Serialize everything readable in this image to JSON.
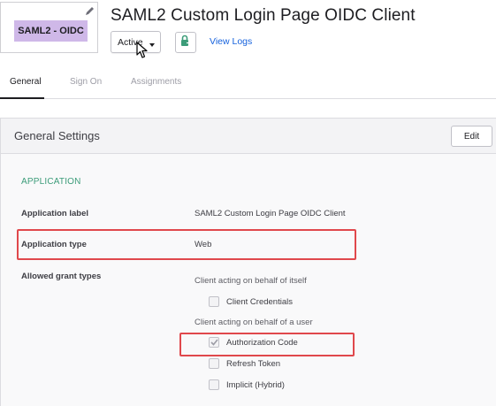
{
  "app": {
    "logo_label": "SAML2 - OIDC",
    "title": "SAML2 Custom Login Page OIDC Client",
    "status": "Active",
    "view_logs": "View Logs"
  },
  "tabs": [
    {
      "label": "General",
      "active": true
    },
    {
      "label": "Sign On",
      "active": false
    },
    {
      "label": "Assignments",
      "active": false
    }
  ],
  "panel": {
    "title": "General Settings",
    "edit_label": "Edit",
    "section": "APPLICATION",
    "fields": {
      "app_label": {
        "label": "Application label",
        "value": "SAML2 Custom Login Page OIDC Client"
      },
      "app_type": {
        "label": "Application type",
        "value": "Web"
      },
      "grant_types": {
        "label": "Allowed grant types"
      }
    },
    "groups": [
      {
        "heading": "Client acting on behalf of itself",
        "options": [
          {
            "label": "Client Credentials",
            "checked": false
          }
        ]
      },
      {
        "heading": "Client acting on behalf of a user",
        "options": [
          {
            "label": "Authorization Code",
            "checked": true
          },
          {
            "label": "Refresh Token",
            "checked": false
          },
          {
            "label": "Implicit (Hybrid)",
            "checked": false
          }
        ]
      }
    ]
  },
  "colors": {
    "accent_link": "#1662dd",
    "section_green": "#3c9c79",
    "highlight_red": "#e0484c",
    "logo_bg": "#cfb8e8"
  }
}
